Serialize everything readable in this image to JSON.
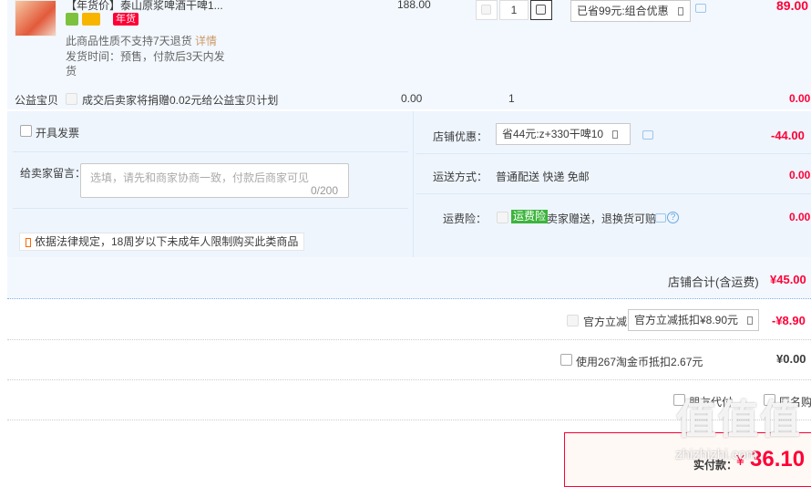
{
  "item": {
    "title": "【年货价】泰山原浆啤酒干啤1...",
    "badge_nianhuo": "年货",
    "notice": "此商品性质不支持7天退货",
    "notice_link": "详情",
    "shipping_line1": "发货时间：预售，付款后3天内发",
    "shipping_line2": "货",
    "price": "188.00",
    "quantity": "1",
    "discount_select": "已省99元:组合优惠",
    "total": "89.00"
  },
  "charity": {
    "label": "公益宝贝",
    "desc": "成交后卖家将捐赠0.02元给公益宝贝计划",
    "price": "0.00",
    "qty": "1",
    "total": "0.00"
  },
  "options": {
    "invoice_label": "开具发票",
    "message_label": "给卖家留言：",
    "message_placeholder": "选填，请先和商家协商一致，付款后商家可见",
    "message_count": "0/200",
    "legal_notice": "依据法律规定，18周岁以下未成年人限制购买此类商品",
    "store_discount_label": "店铺优惠：",
    "store_discount_select": "省44元:z+330干啤10",
    "store_discount_value": "-44.00",
    "shipping_label": "运送方式：",
    "shipping_value": "普通配送 快递 免邮",
    "shipping_amount": "0.00",
    "insurance_label": "运费险：",
    "insurance_badge": "运费险",
    "insurance_desc": "卖家赠送，退换货可赔",
    "insurance_amount": "0.00"
  },
  "store_total": {
    "label": "店铺合计(含运费)",
    "value": "¥45.00"
  },
  "official": {
    "label": "官方立减",
    "select": "官方立减抵扣¥8.90元",
    "value": "-¥8.90"
  },
  "coin": {
    "label": "使用267淘金币抵扣2.67元",
    "value": "¥0.00"
  },
  "checks": {
    "friend_pay": "朋友代付",
    "anonymous": "匿名购买"
  },
  "pay": {
    "label": "实付款：",
    "currency": "¥",
    "value": "36.10"
  },
  "watermark": {
    "big": "值值值",
    "small": "zhizhizhi.com"
  },
  "colors": {
    "accent": "#ff0036",
    "panel": "#f3f8fe",
    "insurance": "#3cb43c"
  }
}
